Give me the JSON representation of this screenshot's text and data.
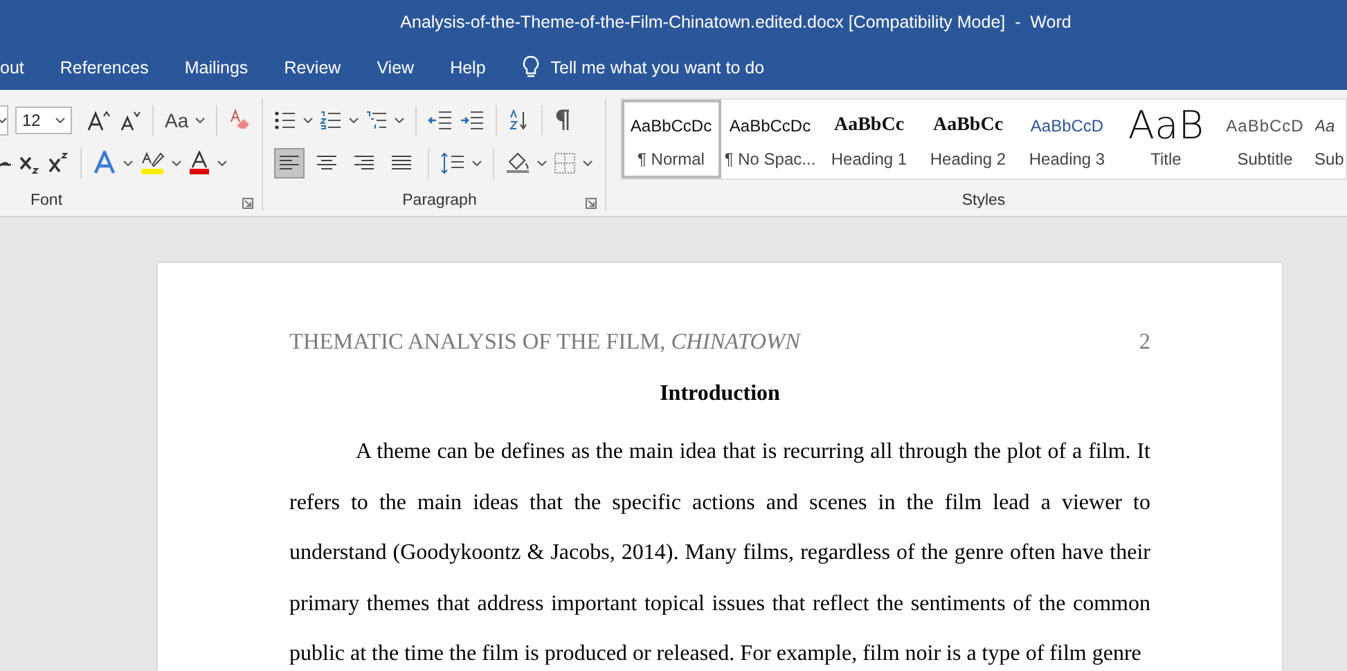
{
  "window": {
    "title": "Analysis-of-the-Theme-of-the-Film-Chinatown.edited.docx [Compatibility Mode]  -  Word"
  },
  "tabs": [
    {
      "label": "out",
      "selected": false
    },
    {
      "label": "References",
      "selected": false
    },
    {
      "label": "Mailings",
      "selected": false
    },
    {
      "label": "Review",
      "selected": false
    },
    {
      "label": "View",
      "selected": false
    },
    {
      "label": "Help",
      "selected": false
    }
  ],
  "tell_me": {
    "placeholder": "Tell me what you want to do"
  },
  "font_group": {
    "label": "Font",
    "font_size": "12",
    "change_case": "Aa"
  },
  "paragraph_group": {
    "label": "Paragraph",
    "align_buttons": [
      {
        "kind": "left",
        "selected": true
      },
      {
        "kind": "center",
        "selected": false
      },
      {
        "kind": "right",
        "selected": false
      },
      {
        "kind": "justify",
        "selected": false
      }
    ]
  },
  "styles_group": {
    "label": "Styles",
    "items": [
      {
        "kind": "normal",
        "preview": "AaBbCcDc",
        "name": "¶ Normal",
        "selected": true
      },
      {
        "kind": "normal",
        "preview": "AaBbCcDc",
        "name": "¶ No Spac...",
        "selected": false
      },
      {
        "kind": "heading1",
        "preview": "AaBbCc",
        "name": "Heading 1",
        "selected": false
      },
      {
        "kind": "heading2",
        "preview": "AaBbCc",
        "name": "Heading 2",
        "selected": false
      },
      {
        "kind": "heading3",
        "preview": "AaBbCcD",
        "name": "Heading 3",
        "selected": false
      },
      {
        "kind": "title",
        "preview": "AaB",
        "name": "Title",
        "selected": false
      },
      {
        "kind": "subtitle",
        "preview": "AaBbCcD",
        "name": "Subtitle",
        "selected": false
      },
      {
        "kind": "emphasis",
        "preview": "Aa",
        "name": "Sub",
        "selected": false
      }
    ]
  },
  "document": {
    "header": "THEMATIC ANALYSIS OF THE FILM, *CHINATOWN*",
    "page_number": "2",
    "heading": "Introduction",
    "paragraph": "A theme can be defines as the main idea that is recurring all through the plot of a film. It refers to the main ideas that the specific actions and scenes in the film lead a viewer to understand (Goodykoontz & Jacobs, 2014). Many films, regardless of the genre often have their primary themes that address important topical issues that reflect the sentiments of the common public at the time the film is produced or released. For example, film noir is a type of film genre"
  }
}
